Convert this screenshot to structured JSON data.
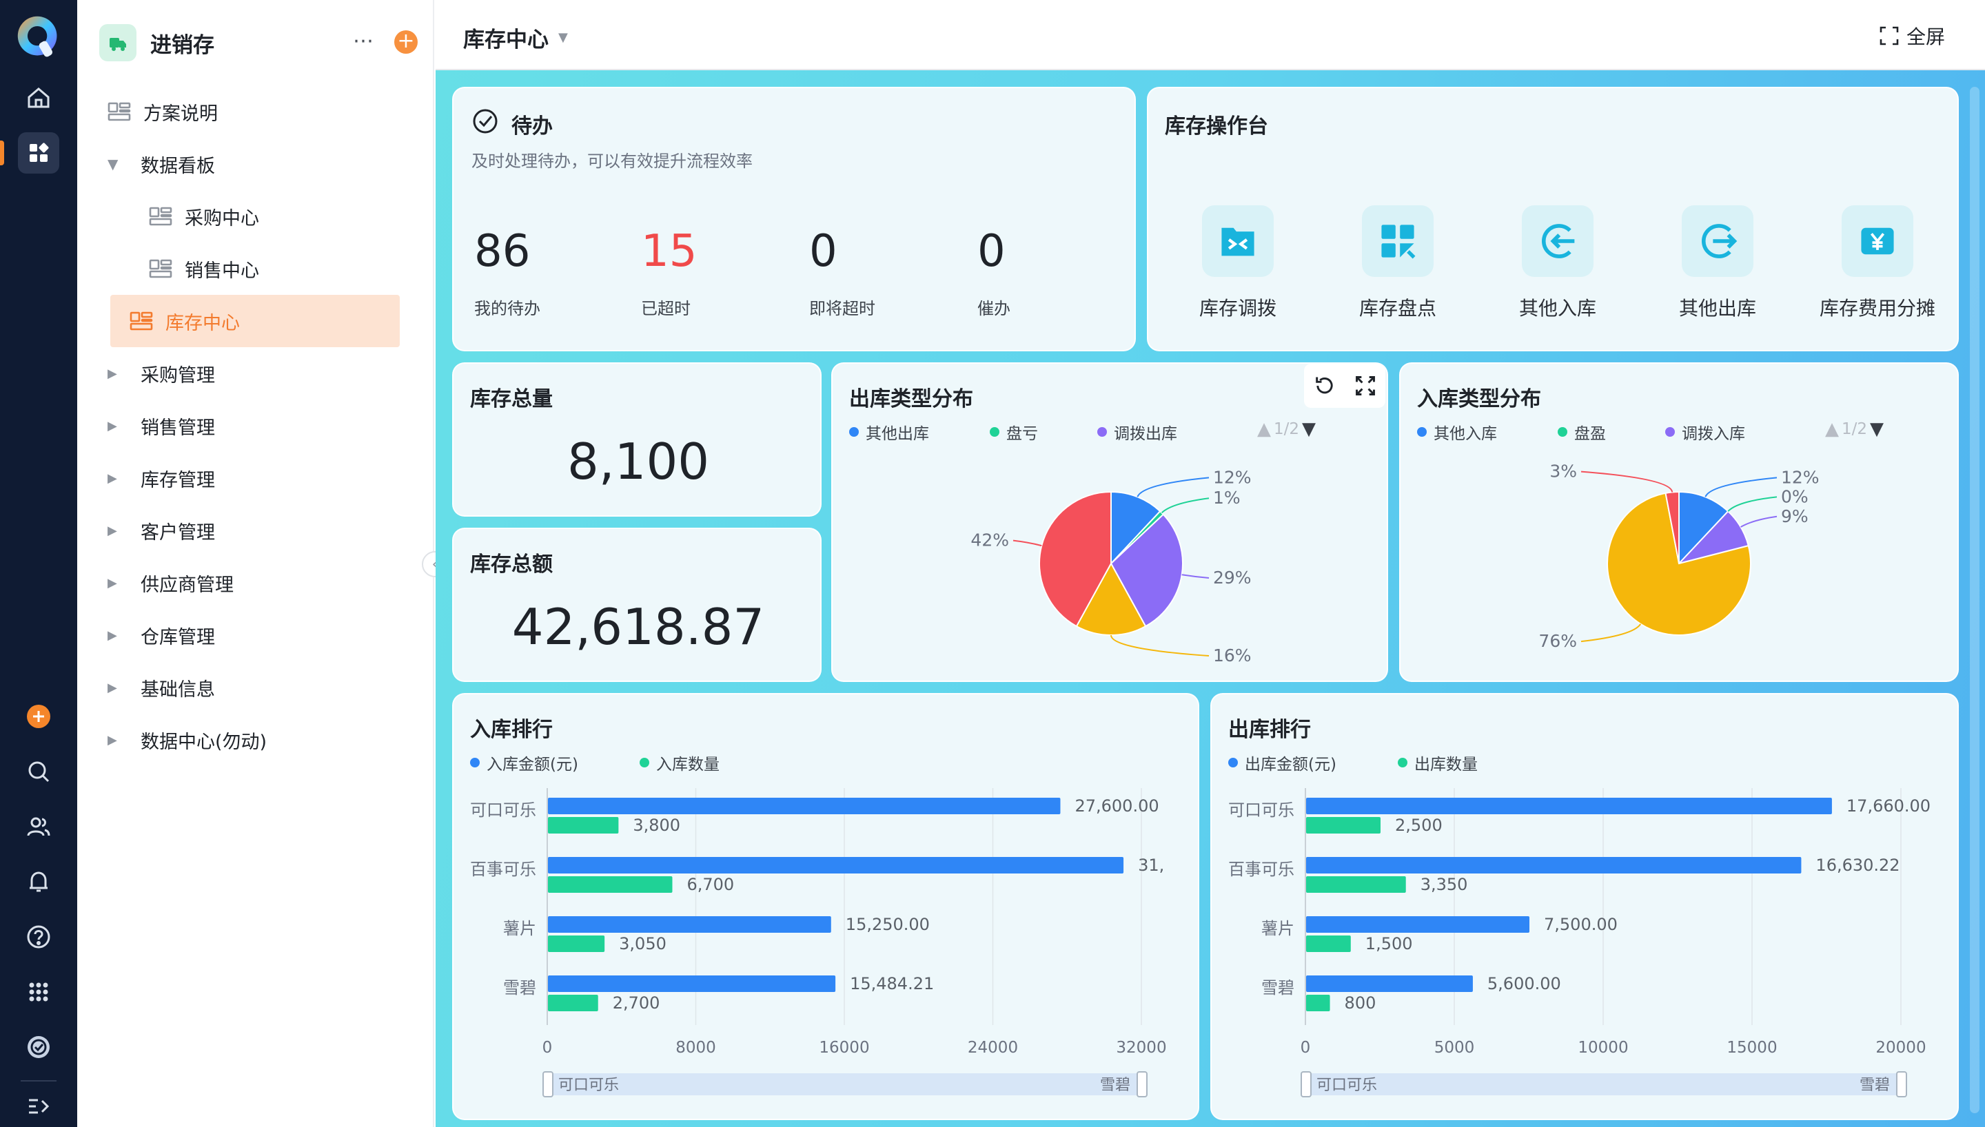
{
  "app": {
    "name": "进销存",
    "more_icon": "more-icon",
    "add_icon": "add-icon"
  },
  "rail": {
    "icons": [
      "app-logo-icon",
      "home-icon",
      "grid-apps-icon",
      "add-circle-icon",
      "search-icon",
      "users-icon",
      "bell-icon",
      "help-icon",
      "apps-dots-icon",
      "sync-icon",
      "expand-menu-icon"
    ]
  },
  "sidebar": {
    "items": [
      {
        "label": "方案说明",
        "type": "doc"
      },
      {
        "label": "数据看板",
        "type": "group-open"
      },
      {
        "label": "采购中心",
        "type": "child"
      },
      {
        "label": "销售中心",
        "type": "child"
      },
      {
        "label": "库存中心",
        "type": "child-active"
      },
      {
        "label": "采购管理",
        "type": "group"
      },
      {
        "label": "销售管理",
        "type": "group"
      },
      {
        "label": "库存管理",
        "type": "group"
      },
      {
        "label": "客户管理",
        "type": "group"
      },
      {
        "label": "供应商管理",
        "type": "group"
      },
      {
        "label": "仓库管理",
        "type": "group"
      },
      {
        "label": "基础信息",
        "type": "group"
      },
      {
        "label": "数据中心(勿动)",
        "type": "group"
      }
    ]
  },
  "header": {
    "title": "库存中心",
    "fullscreen_label": "全屏"
  },
  "todo": {
    "title": "待办",
    "subtitle": "及时处理待办，可以有效提升流程效率",
    "stats": [
      {
        "value": "86",
        "label": "我的待办",
        "color": "#1f2329"
      },
      {
        "value": "15",
        "label": "已超时",
        "color": "#f04a4a"
      },
      {
        "value": "0",
        "label": "即将超时",
        "color": "#1f2329"
      },
      {
        "value": "0",
        "label": "催办",
        "color": "#1f2329"
      }
    ]
  },
  "operations": {
    "title": "库存操作台",
    "items": [
      {
        "label": "库存调拨",
        "icon": "transfer-icon"
      },
      {
        "label": "库存盘点",
        "icon": "inventory-check-icon"
      },
      {
        "label": "其他入库",
        "icon": "stock-in-icon"
      },
      {
        "label": "其他出库",
        "icon": "stock-out-icon"
      },
      {
        "label": "库存费用分摊",
        "icon": "yen-cost-icon"
      }
    ]
  },
  "totals": {
    "qty_title": "库存总量",
    "qty_value": "8,100",
    "amount_title": "库存总额",
    "amount_value": "42,618.87"
  },
  "colors": {
    "blue": "#2f86f6",
    "green": "#1fd296",
    "purple": "#8b6cf6",
    "red": "#f4505a",
    "yellow": "#f5b70b",
    "active_bg": "#fde3d2",
    "active_text": "#f37b2e"
  },
  "chart_data": [
    {
      "type": "pie",
      "title": "出库类型分布",
      "legend": [
        "其他出库",
        "盘亏",
        "调拨出库"
      ],
      "pager": "1/2",
      "slices": [
        {
          "name": "其他出库",
          "value": 12,
          "color": "#2f86f6"
        },
        {
          "name": "盘亏",
          "value": 1,
          "color": "#1fd296"
        },
        {
          "name": "调拨出库",
          "value": 29,
          "color": "#8b6cf6"
        },
        {
          "name": "",
          "value": 16,
          "color": "#f5b70b"
        },
        {
          "name": "",
          "value": 42,
          "color": "#f4505a"
        }
      ]
    },
    {
      "type": "pie",
      "title": "入库类型分布",
      "legend": [
        "其他入库",
        "盘盈",
        "调拨入库"
      ],
      "pager": "1/2",
      "slices": [
        {
          "name": "其他入库",
          "value": 12,
          "color": "#2f86f6"
        },
        {
          "name": "盘盈",
          "value": 0,
          "color": "#1fd296"
        },
        {
          "name": "调拨入库",
          "value": 9,
          "color": "#8b6cf6"
        },
        {
          "name": "",
          "value": 76,
          "color": "#f5b70b"
        },
        {
          "name": "",
          "value": 3,
          "color": "#f4505a"
        }
      ]
    },
    {
      "type": "bar",
      "orientation": "horizontal",
      "title": "入库排行",
      "categories": [
        "可口可乐",
        "百事可乐",
        "薯片",
        "雪碧"
      ],
      "series": [
        {
          "name": "入库金额(元)",
          "values": [
            27600,
            31000,
            15250,
            15484.21
          ],
          "labels": [
            "27,600.00",
            "31,",
            "15,250.00",
            "15,484.21"
          ],
          "color": "#2f86f6"
        },
        {
          "name": "入库数量",
          "values": [
            3800,
            6700,
            3050,
            2700
          ],
          "labels": [
            "3,800",
            "6,700",
            "3,050",
            "2,700"
          ],
          "color": "#1fd296"
        }
      ],
      "xlim": [
        0,
        32000
      ],
      "xticks": [
        "0",
        "8000",
        "16000",
        "24000",
        "32000"
      ],
      "zoom_range": [
        "可口可乐",
        "雪碧"
      ]
    },
    {
      "type": "bar",
      "orientation": "horizontal",
      "title": "出库排行",
      "categories": [
        "可口可乐",
        "百事可乐",
        "薯片",
        "雪碧"
      ],
      "series": [
        {
          "name": "出库金额(元)",
          "values": [
            17660,
            16630.22,
            7500,
            5600
          ],
          "labels": [
            "17,660.00",
            "16,630.22",
            "7,500.00",
            "5,600.00"
          ],
          "color": "#2f86f6"
        },
        {
          "name": "出库数量",
          "values": [
            2500,
            3350,
            1500,
            800
          ],
          "labels": [
            "2,500",
            "3,350",
            "1,500",
            "800"
          ],
          "color": "#1fd296"
        }
      ],
      "xlim": [
        0,
        20000
      ],
      "xticks": [
        "0",
        "5000",
        "10000",
        "15000",
        "20000"
      ],
      "zoom_range": [
        "可口可乐",
        "雪碧"
      ]
    }
  ]
}
